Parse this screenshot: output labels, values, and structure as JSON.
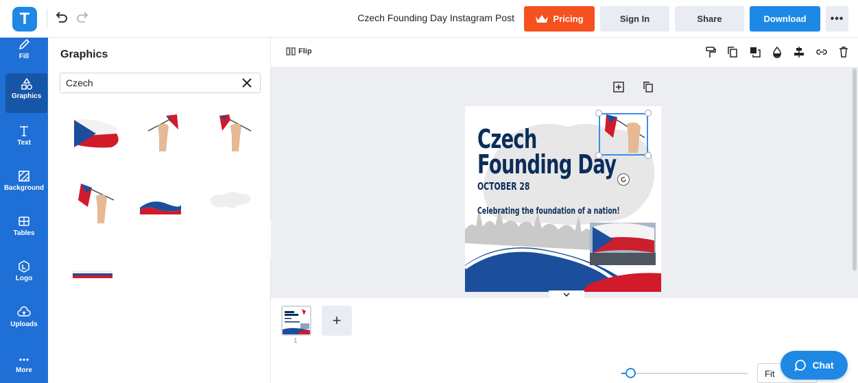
{
  "topbar": {
    "logo_letter": "T",
    "document_title": "Czech Founding Day Instagram Post",
    "pricing_label": "Pricing",
    "signin_label": "Sign In",
    "share_label": "Share",
    "download_label": "Download",
    "more_label": "•••",
    "colors": {
      "brand": "#1e88e5",
      "pricing": "#f5511e"
    }
  },
  "sidebar": {
    "items": [
      {
        "label": "Fill",
        "icon": "pencil-icon"
      },
      {
        "label": "Graphics",
        "icon": "shapes-icon",
        "active": true
      },
      {
        "label": "Text",
        "icon": "text-icon"
      },
      {
        "label": "Background",
        "icon": "background-icon"
      },
      {
        "label": "Tables",
        "icon": "table-icon"
      },
      {
        "label": "Logo",
        "icon": "logo-icon"
      },
      {
        "label": "Uploads",
        "icon": "cloud-upload-icon"
      },
      {
        "label": "More",
        "icon": "more-dots-icon"
      }
    ]
  },
  "panel": {
    "title": "Graphics",
    "search_value": "Czech",
    "results": [
      "czech-flag-brush",
      "hand-holding-flag",
      "hand-holding-flag-mirrored",
      "hand-waving-flag",
      "wave-stripe",
      "czech-map-silhouette",
      "flag-stripe"
    ]
  },
  "editor": {
    "flip_label": "Flip",
    "toolbar_icons": [
      "paint-roller-icon",
      "duplicate-icon",
      "layer-icon",
      "opacity-icon",
      "align-icon",
      "link-icon",
      "trash-icon"
    ]
  },
  "design": {
    "title_line1": "Czech",
    "title_line2": "Founding Day",
    "date": "OCTOBER 28",
    "tagline": "Celebrating the foundation of a nation!",
    "colors": {
      "navy": "#0c2d5a",
      "red": "#d11a2a",
      "blue": "#1b4f9c"
    }
  },
  "pages": {
    "current_number": "1",
    "add_label": "+"
  },
  "zoom": {
    "fit_label": "Fit",
    "level": 0.05
  },
  "chat": {
    "label": "Chat"
  }
}
